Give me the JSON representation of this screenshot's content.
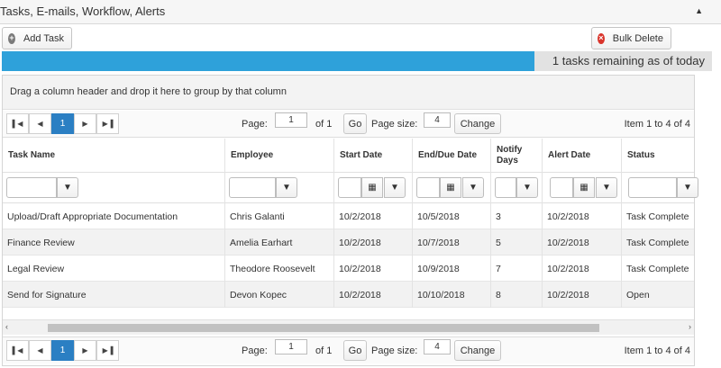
{
  "panel": {
    "title": "Tasks, E-mails, Workflow, Alerts",
    "collapse_icon": "triangle-up-icon"
  },
  "toolbar": {
    "add_task_label": "Add Task",
    "add_icon": "plus-circle-icon",
    "bulk_delete_label": "Bulk Delete",
    "delete_icon": "x-circle-icon"
  },
  "progress": {
    "fraction": 0.75,
    "text": "1 tasks remaining as of today",
    "color": "#2ea1da"
  },
  "grid": {
    "group_hint": "Drag a column header and drop it here to group by that column",
    "columns": [
      "Task Name",
      "Employee",
      "Start Date",
      "End/Due Date",
      "Notify Days",
      "Alert Date",
      "Status"
    ],
    "rows": [
      [
        "Upload/Draft Appropriate Documentation",
        "Chris Galanti",
        "10/2/2018",
        "10/5/2018",
        "3",
        "10/2/2018",
        "Task Complete"
      ],
      [
        "Finance Review",
        "Amelia Earhart",
        "10/2/2018",
        "10/7/2018",
        "5",
        "10/2/2018",
        "Task Complete"
      ],
      [
        "Legal Review",
        "Theodore Roosevelt",
        "10/2/2018",
        "10/9/2018",
        "7",
        "10/2/2018",
        "Task Complete"
      ],
      [
        "Send for Signature",
        "Devon Kopec",
        "10/2/2018",
        "10/10/2018",
        "8",
        "10/2/2018",
        "Open"
      ]
    ]
  },
  "pager": {
    "first_icon": "first-page-icon",
    "prev_icon": "prev-page-icon",
    "current_page": "1",
    "next_icon": "next-page-icon",
    "last_icon": "last-page-icon",
    "page_label": "Page:",
    "page_value": "1",
    "of_label": "of 1",
    "go_label": "Go",
    "size_label": "Page size:",
    "size_value": "4",
    "change_label": "Change",
    "info": "Item 1 to 4 of 4"
  },
  "scrollbar": {
    "left_icon": "scroll-left-icon",
    "right_icon": "scroll-right-icon"
  }
}
